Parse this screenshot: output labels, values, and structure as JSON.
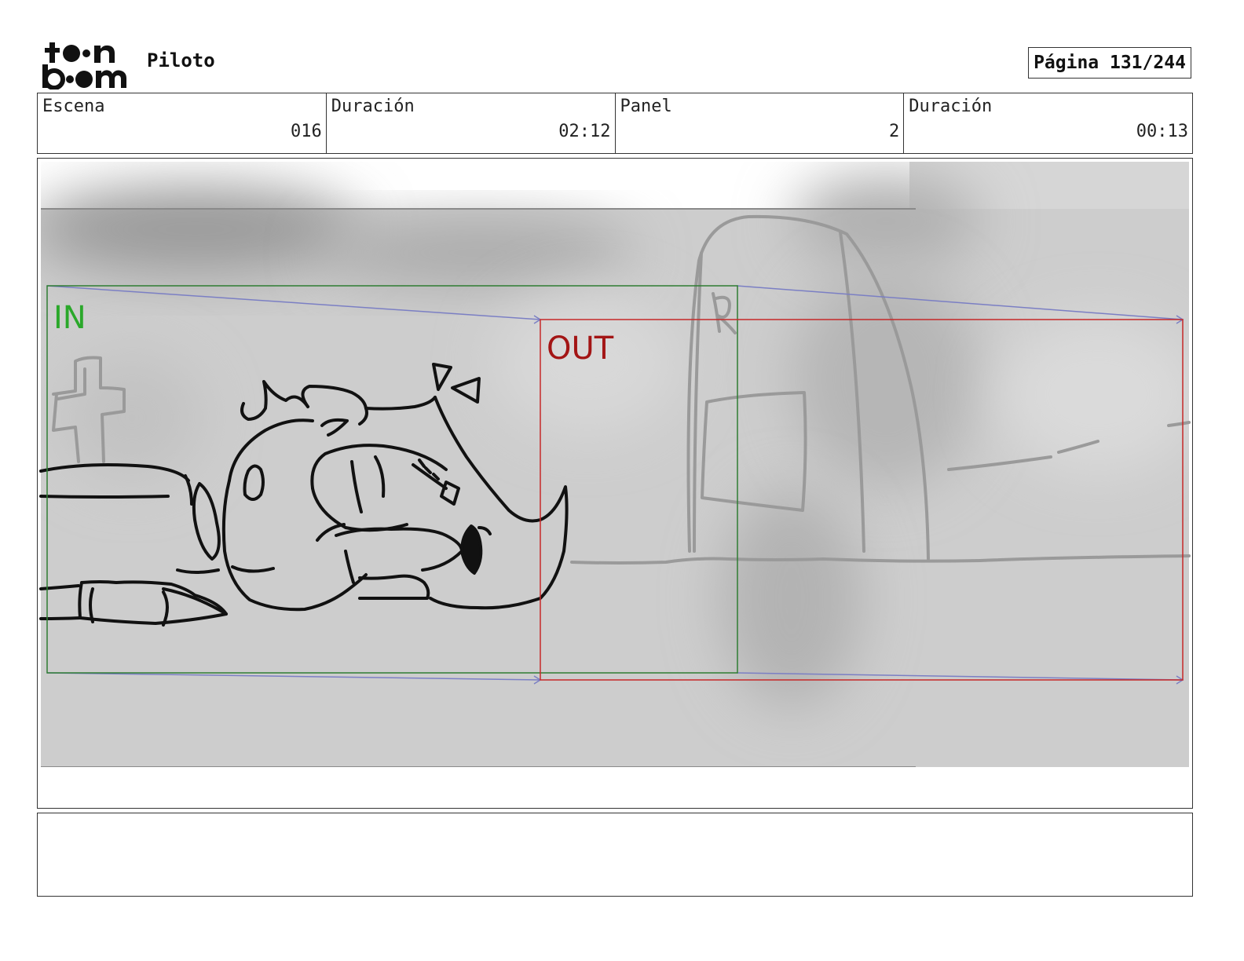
{
  "header": {
    "logo_text_line1": "toon",
    "logo_text_line2": "boom",
    "project_title": "Piloto",
    "page_indicator": "Página 131/244"
  },
  "info": {
    "scene_label": "Escena",
    "scene_value": "016",
    "scene_duration_label": "Duración",
    "scene_duration_value": "02:12",
    "panel_label": "Panel",
    "panel_value": "2",
    "panel_duration_label": "Duración",
    "panel_duration_value": "00:13"
  },
  "panel": {
    "camera_in_label": "IN",
    "camera_out_label": "OUT",
    "colors": {
      "in_frame": "#2e7d32",
      "out_frame": "#c62828",
      "motion_arrows": "#7b7fc4"
    }
  },
  "notes": {
    "text": ""
  }
}
